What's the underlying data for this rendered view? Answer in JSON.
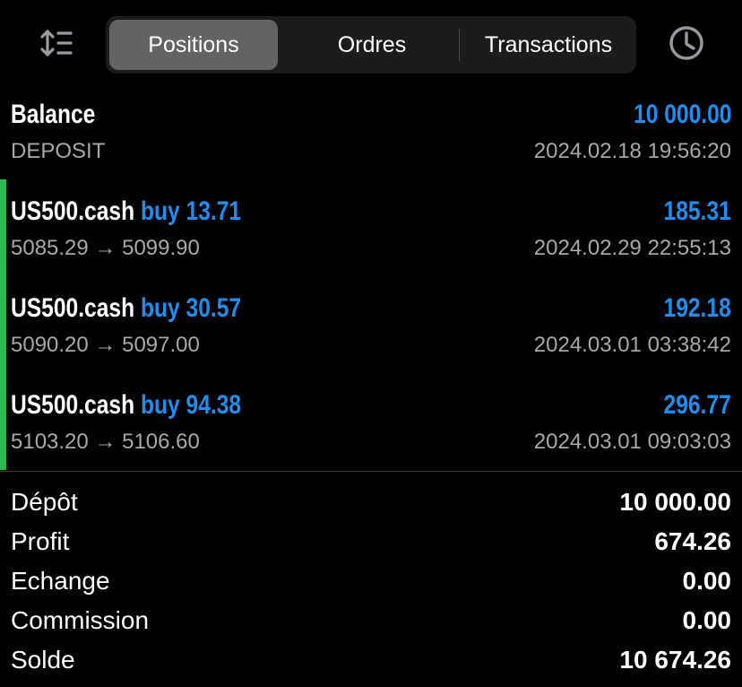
{
  "tabs": {
    "positions": "Positions",
    "ordres": "Ordres",
    "transactions": "Transactions",
    "active": "positions"
  },
  "icons": {
    "sort": "sort-icon",
    "history": "clock-icon"
  },
  "balance": {
    "label": "Balance",
    "value": "10 000.00",
    "type": "DEPOSIT",
    "datetime": "2024.02.18 19:56:20"
  },
  "deals": [
    {
      "symbol": "US500.cash",
      "side_volume": "buy 13.71",
      "profit": "185.31",
      "prices": "5085.29 → 5099.90",
      "datetime": "2024.02.29 22:55:13"
    },
    {
      "symbol": "US500.cash",
      "side_volume": "buy 30.57",
      "profit": "192.18",
      "prices": "5090.20 → 5097.00",
      "datetime": "2024.03.01 03:38:42"
    },
    {
      "symbol": "US500.cash",
      "side_volume": "buy 94.38",
      "profit": "296.77",
      "prices": "5103.20 → 5106.60",
      "datetime": "2024.03.01 09:03:03"
    }
  ],
  "summary": [
    {
      "label": "Dépôt",
      "value": "10 000.00"
    },
    {
      "label": "Profit",
      "value": "674.26"
    },
    {
      "label": "Echange",
      "value": "0.00"
    },
    {
      "label": "Commission",
      "value": "0.00"
    },
    {
      "label": "Solde",
      "value": "10 674.26"
    }
  ],
  "colors": {
    "background": "#000000",
    "accent_blue": "#1e8ef0",
    "buy_bar_green": "#2db84d",
    "secondary_text": "#a8a8ad",
    "segment_active": "#636366"
  }
}
